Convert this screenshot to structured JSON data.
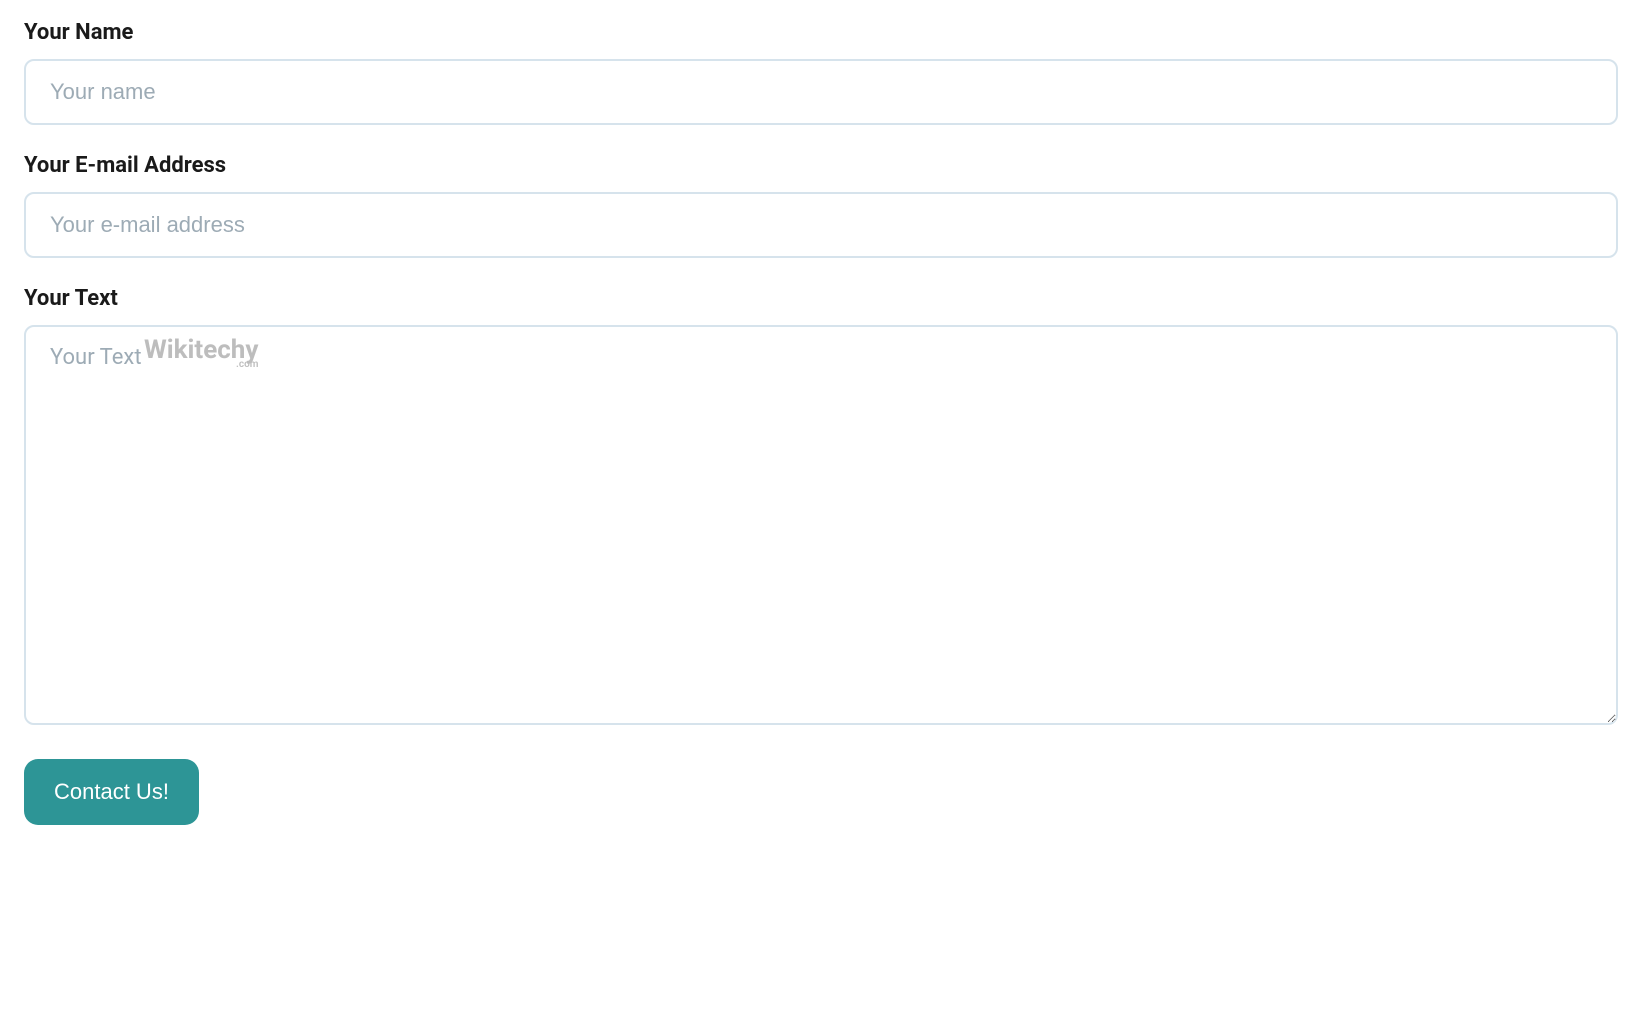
{
  "form": {
    "name": {
      "label": "Your Name",
      "placeholder": "Your name",
      "value": ""
    },
    "email": {
      "label": "Your E-mail Address",
      "placeholder": "Your e-mail address",
      "value": ""
    },
    "text": {
      "label": "Your  Text",
      "placeholder": "Your Text",
      "value": ""
    },
    "submit_label": "Contact Us!"
  },
  "watermark": {
    "text": "Wikitechy",
    "suffix": ".com"
  }
}
